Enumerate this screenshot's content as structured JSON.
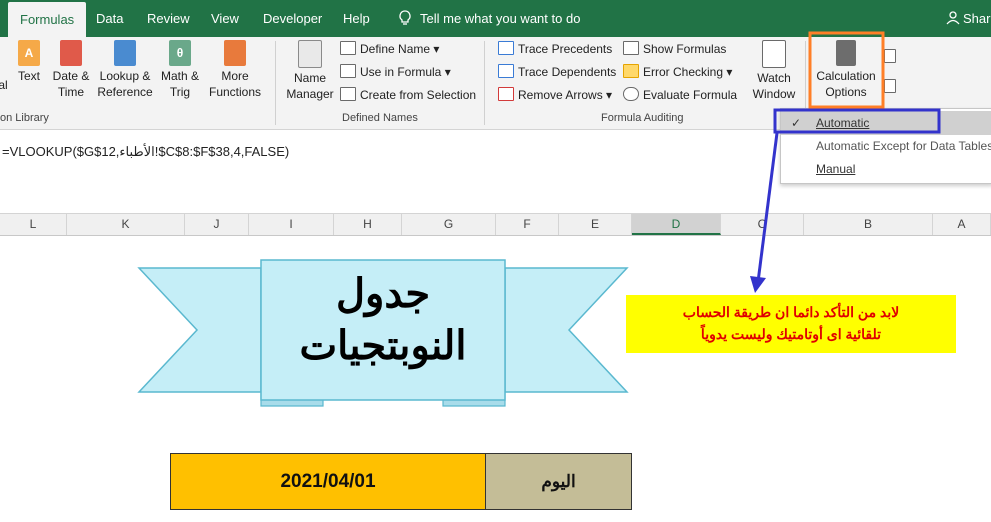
{
  "tabs": [
    {
      "label": "Formulas",
      "active": true
    },
    {
      "label": "Data"
    },
    {
      "label": "Review"
    },
    {
      "label": "View"
    },
    {
      "label": "Developer"
    },
    {
      "label": "Help"
    }
  ],
  "tell_me": "Tell me what you want to do",
  "share": "Share",
  "ribbon": {
    "library": {
      "partial_left": "al",
      "text": "Text",
      "datetime": "Date &\nTime",
      "lookup": "Lookup &\nReference",
      "math": "Math &\nTrig",
      "more": "More\nFunctions",
      "group_label": "on Library"
    },
    "names": {
      "name_manager": "Name\nManager",
      "define_name": "Define Name",
      "use_in_formula": "Use in Formula",
      "create_from_selection": "Create from Selection",
      "group_label": "Defined Names"
    },
    "auditing": {
      "trace_precedents": "Trace Precedents",
      "trace_dependents": "Trace Dependents",
      "remove_arrows": "Remove Arrows",
      "show_formulas": "Show Formulas",
      "error_checking": "Error Checking",
      "evaluate_formula": "Evaluate Formula",
      "watch_window": "Watch\nWindow",
      "group_label": "Formula Auditing"
    },
    "calculation": {
      "options": "Calculation\nOptions"
    }
  },
  "menu": {
    "items": [
      {
        "label": "Automatic",
        "checked": true
      },
      {
        "label": "Automatic Except for Data Tables"
      },
      {
        "label": "Manual"
      }
    ]
  },
  "formula": "=VLOOKUP($G$12,الأطباء!$C$8:$F$38,4,FALSE)",
  "columns": [
    "L",
    "K",
    "J",
    "I",
    "H",
    "G",
    "F",
    "E",
    "D",
    "C",
    "B",
    "A"
  ],
  "selected_column": "D",
  "banner": {
    "line1": "جدول",
    "line2": "النوبتجيات"
  },
  "note": {
    "line1": "لابد من التأكد دائما ان طريقة الحساب",
    "line2": "تلقائية اى أوتامتيك وليست يدوياً"
  },
  "date_value": "2021/04/01",
  "day_label": "اليوم",
  "colors": {
    "excel_green": "#217346",
    "highlight_orange": "#ff7f27",
    "highlight_blue": "#3333cc",
    "date_fill": "#ffc000",
    "day_fill": "#c4bd97",
    "note_fill": "#ffff00",
    "note_text": "#e00000",
    "banner_fill": "#c5eef7"
  }
}
